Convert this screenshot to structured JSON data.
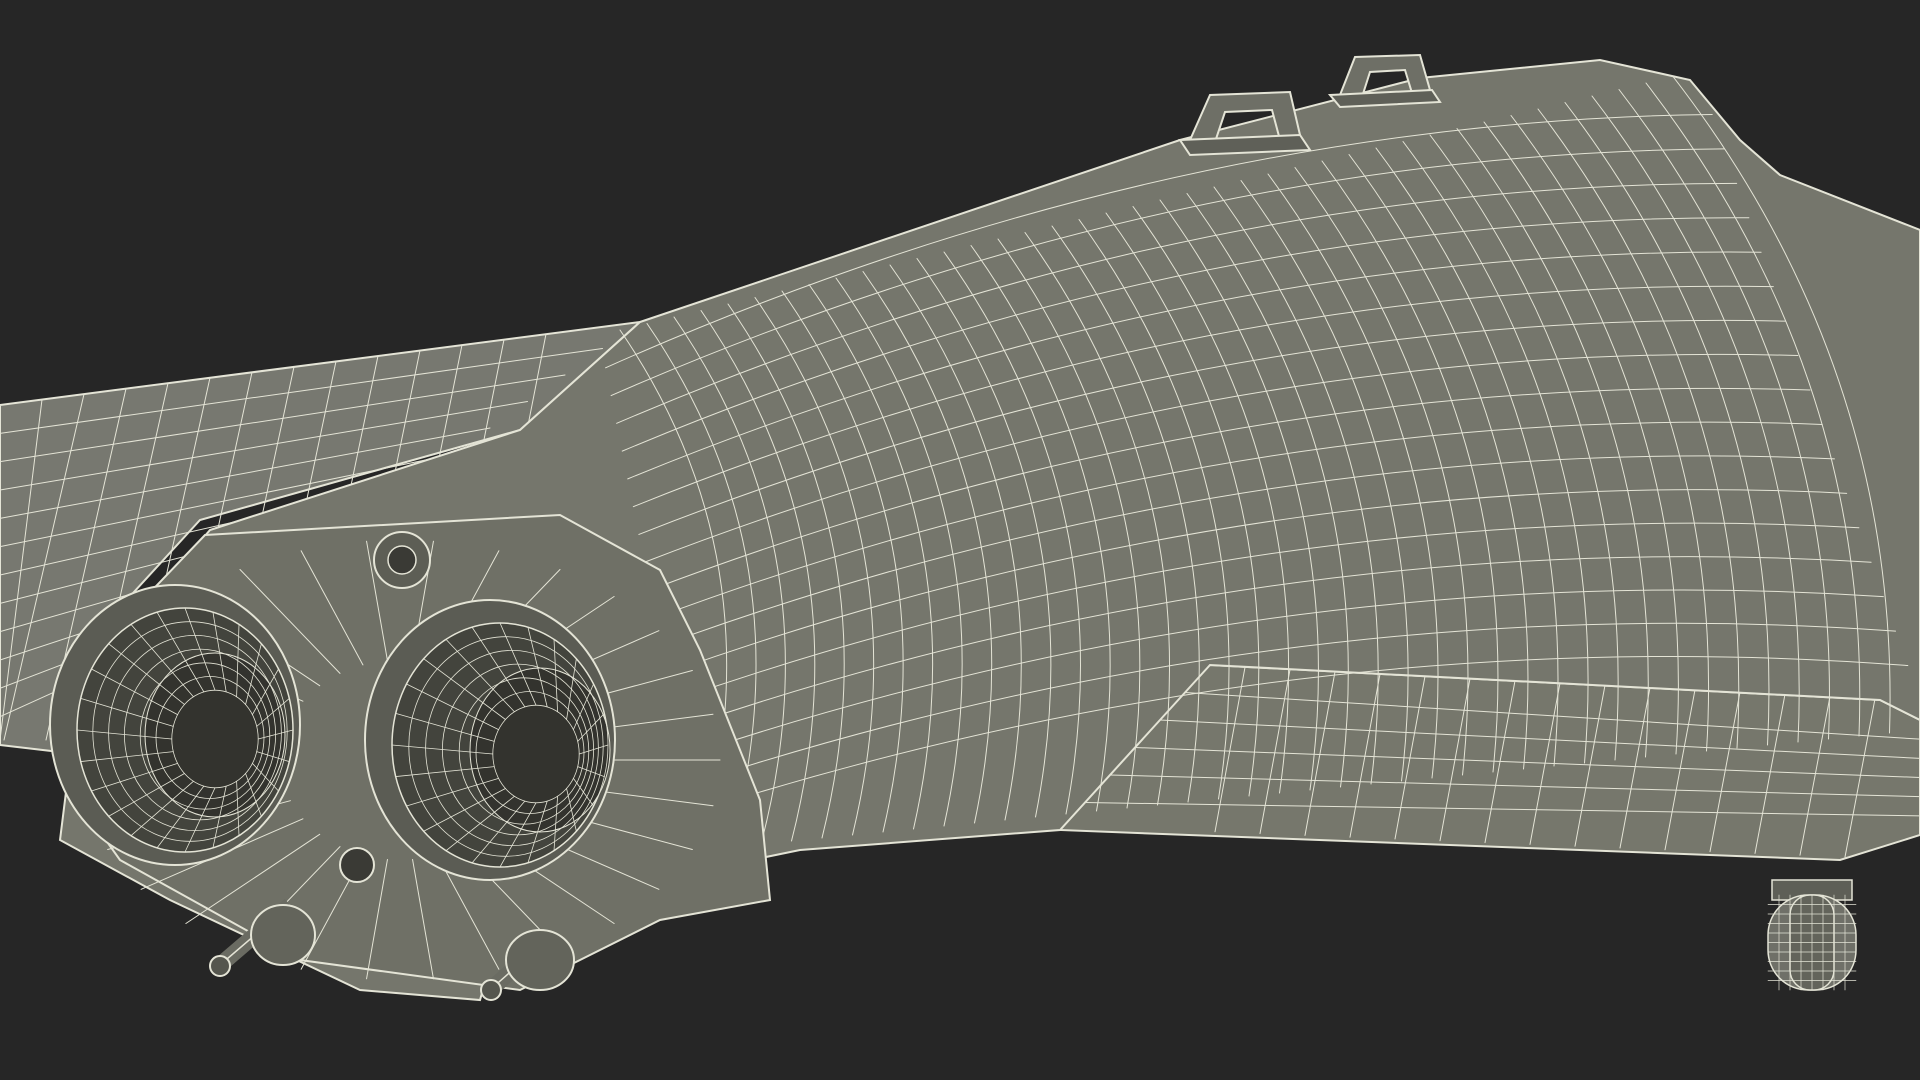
{
  "scene": {
    "subject": "wireframe-aircraft-model",
    "parts": [
      "left-wing",
      "fuselage-body",
      "right-wing",
      "exhaust-nozzle-left",
      "exhaust-nozzle-right",
      "antenna-mount-front",
      "antenna-mount-rear",
      "landing-gear-wheel",
      "exhaust-pipes"
    ]
  },
  "colors": {
    "background": "#262626",
    "surface": "#76776c",
    "surface_dark": "#64655b",
    "surface_shadow": "#4d4e46",
    "nozzle_inner": "#3f3f39",
    "nozzle_deep": "#2e2e2a",
    "wire": "#e4e4d6"
  }
}
